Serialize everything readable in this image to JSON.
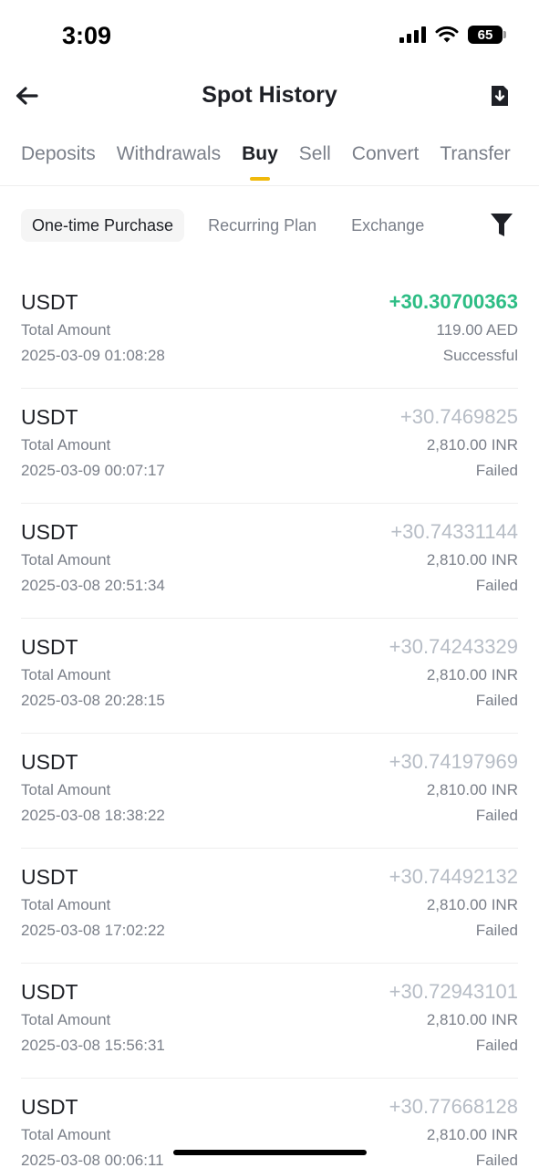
{
  "status_bar": {
    "time": "3:09",
    "battery": "65"
  },
  "header": {
    "title": "Spot History",
    "back_icon": "arrow-left-icon",
    "download_icon": "download-icon"
  },
  "tabs": [
    {
      "label": "Deposits",
      "active": false
    },
    {
      "label": "Withdrawals",
      "active": false
    },
    {
      "label": "Buy",
      "active": true
    },
    {
      "label": "Sell",
      "active": false
    },
    {
      "label": "Convert",
      "active": false
    },
    {
      "label": "Transfer",
      "active": false
    }
  ],
  "subtabs": [
    {
      "label": "One-time Purchase",
      "active": true
    },
    {
      "label": "Recurring Plan",
      "active": false
    },
    {
      "label": "Exchange",
      "active": false
    }
  ],
  "filter_icon": "filter-icon",
  "colors": {
    "accent": "#f0b90b",
    "success": "#2ebd85",
    "muted": "#b7bdc6"
  },
  "transactions": [
    {
      "asset": "USDT",
      "label": "Total Amount",
      "time": "2025-03-09 01:08:28",
      "amount": "+30.30700363",
      "fiat": "119.00 AED",
      "status": "Successful"
    },
    {
      "asset": "USDT",
      "label": "Total Amount",
      "time": "2025-03-09 00:07:17",
      "amount": "+30.7469825",
      "fiat": "2,810.00 INR",
      "status": "Failed"
    },
    {
      "asset": "USDT",
      "label": "Total Amount",
      "time": "2025-03-08 20:51:34",
      "amount": "+30.74331144",
      "fiat": "2,810.00 INR",
      "status": "Failed"
    },
    {
      "asset": "USDT",
      "label": "Total Amount",
      "time": "2025-03-08 20:28:15",
      "amount": "+30.74243329",
      "fiat": "2,810.00 INR",
      "status": "Failed"
    },
    {
      "asset": "USDT",
      "label": "Total Amount",
      "time": "2025-03-08 18:38:22",
      "amount": "+30.74197969",
      "fiat": "2,810.00 INR",
      "status": "Failed"
    },
    {
      "asset": "USDT",
      "label": "Total Amount",
      "time": "2025-03-08 17:02:22",
      "amount": "+30.74492132",
      "fiat": "2,810.00 INR",
      "status": "Failed"
    },
    {
      "asset": "USDT",
      "label": "Total Amount",
      "time": "2025-03-08 15:56:31",
      "amount": "+30.72943101",
      "fiat": "2,810.00 INR",
      "status": "Failed"
    },
    {
      "asset": "USDT",
      "label": "Total Amount",
      "time": "2025-03-08 00:06:11",
      "amount": "+30.77668128",
      "fiat": "2,810.00 INR",
      "status": "Failed"
    }
  ]
}
